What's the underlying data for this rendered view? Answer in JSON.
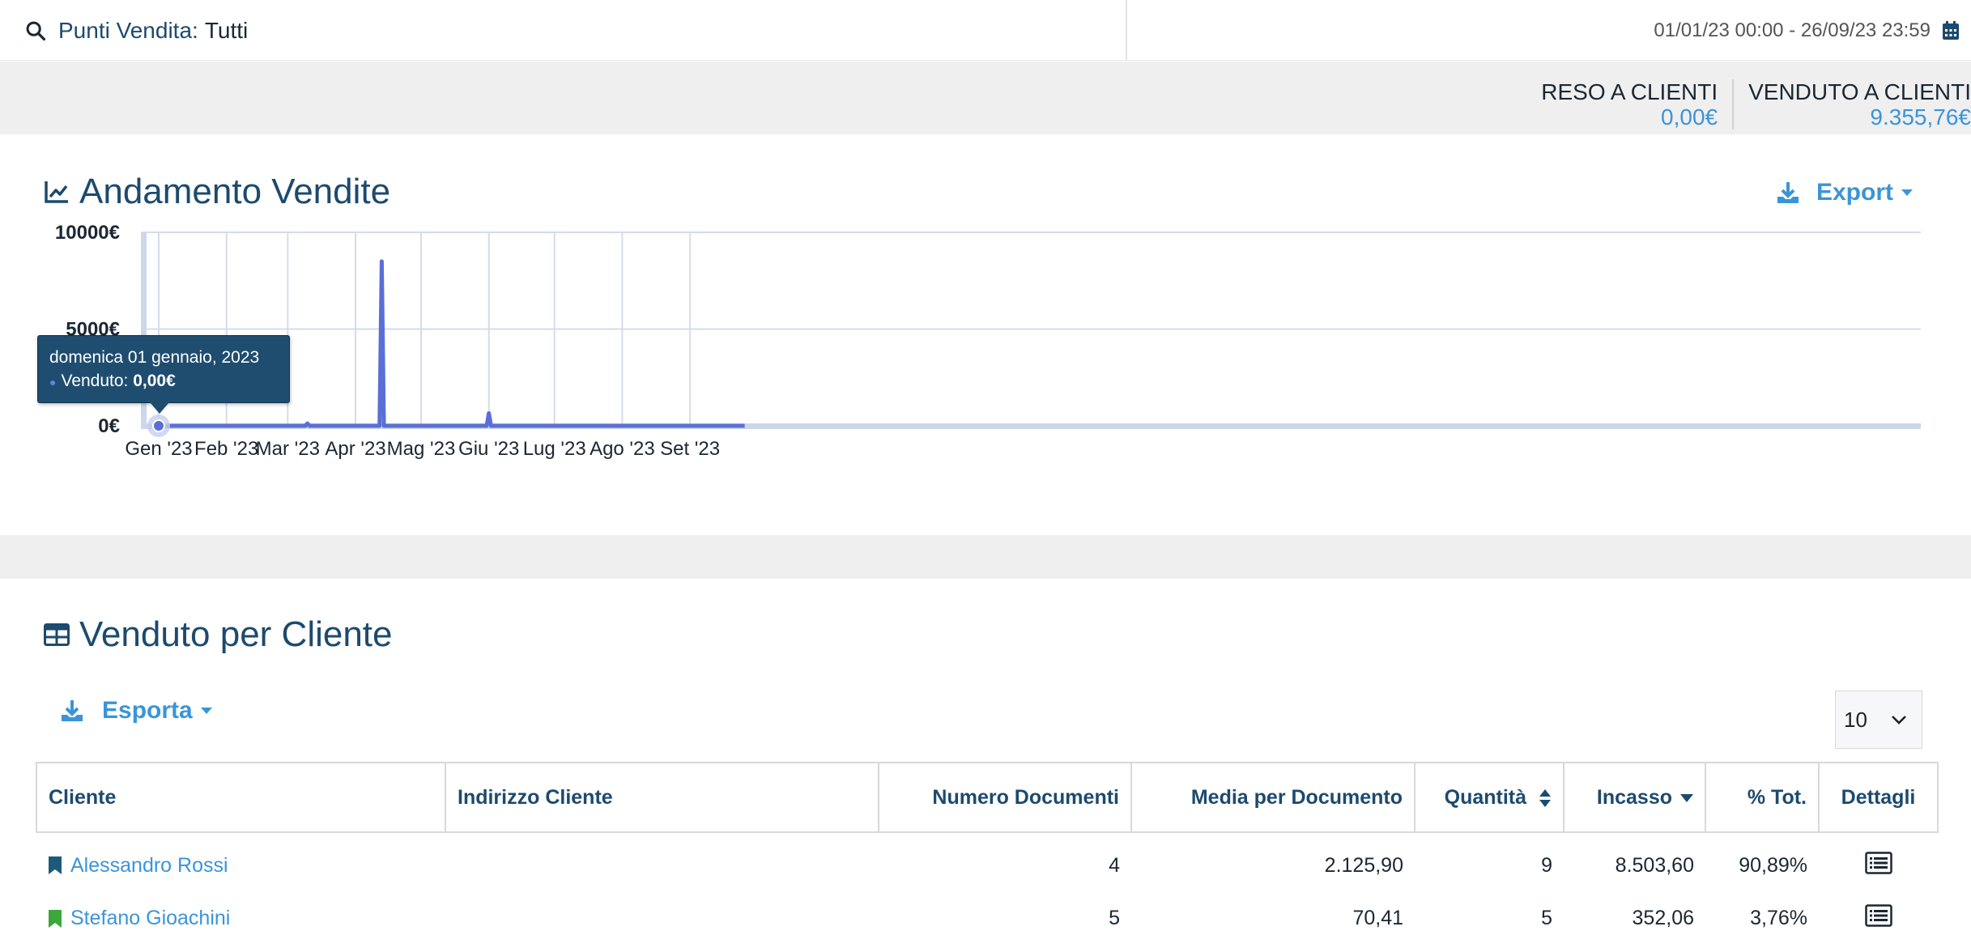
{
  "filter": {
    "label": "Punti Vendita:",
    "value": "Tutti"
  },
  "date_range": "01/01/23 00:00 - 26/09/23 23:59",
  "totals": [
    {
      "label": "RESO A CLIENTI",
      "value": "0,00€"
    },
    {
      "label": "VENDUTO A CLIENTI",
      "value": "9.355,76€"
    }
  ],
  "chart_panel": {
    "title": "Andamento Vendite",
    "export_label": "Export"
  },
  "tooltip": {
    "date": "domenica 01 gennaio, 2023",
    "series": "Venduto:",
    "value": "0,00€"
  },
  "chart_data": {
    "type": "line",
    "title": "",
    "xlabel": "",
    "ylabel": "",
    "ylim": [
      0,
      10000
    ],
    "y_ticks": [
      "0€",
      "5000€",
      "10000€"
    ],
    "x_ticks": [
      "Gen '23",
      "Feb '23",
      "Mar '23",
      "Apr '23",
      "Mag '23",
      "Giu '23",
      "Lug '23",
      "Ago '23",
      "Set '23"
    ],
    "series": [
      {
        "name": "Venduto",
        "color": "#5a6fd6",
        "points": [
          {
            "x": "2023-01-01",
            "y": 0
          },
          {
            "x": "2023-03-09",
            "y": 0
          },
          {
            "x": "2023-03-10",
            "y": 120
          },
          {
            "x": "2023-03-11",
            "y": 0
          },
          {
            "x": "2023-04-12",
            "y": 0
          },
          {
            "x": "2023-04-13",
            "y": 8500
          },
          {
            "x": "2023-04-14",
            "y": 0
          },
          {
            "x": "2023-05-31",
            "y": 0
          },
          {
            "x": "2023-06-01",
            "y": 650
          },
          {
            "x": "2023-06-02",
            "y": 0
          },
          {
            "x": "2023-09-26",
            "y": 0
          }
        ]
      }
    ]
  },
  "table_panel": {
    "title": "Venduto per Cliente",
    "export_label": "Esporta",
    "page_size": "10"
  },
  "table": {
    "headers": [
      "Cliente",
      "Indirizzo Cliente",
      "Numero Documenti",
      "Media per Documento",
      "Quantità",
      "Incasso",
      "% Tot.",
      "Dettagli"
    ],
    "rows": [
      {
        "cliente": "Alessandro Rossi",
        "indirizzo": "",
        "documenti": "4",
        "media": "2.125,90",
        "quantita": "9",
        "incasso": "8.503,60",
        "perc": "90,89%",
        "bookmark_color": "#1d5a7a"
      },
      {
        "cliente": "Stefano Gioachini",
        "indirizzo": "",
        "documenti": "5",
        "media": "70,41",
        "quantita": "5",
        "incasso": "352,06",
        "perc": "3,76%",
        "bookmark_color": "#3aa83a"
      }
    ]
  }
}
